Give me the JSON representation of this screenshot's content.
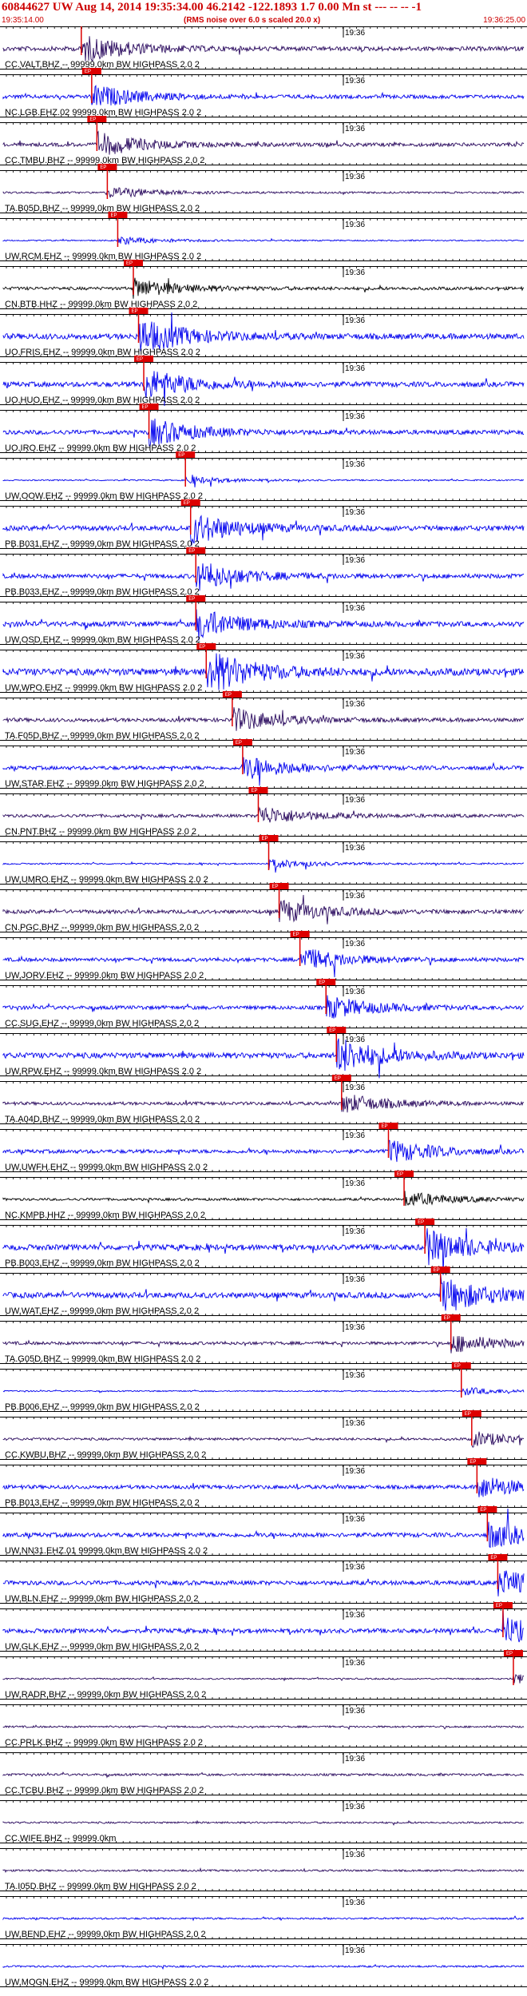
{
  "header": {
    "title": "60844627 UW Aug 14, 2014 19:35:34.00   46.2142 -122.1893  1.7 0.00 Mn st --- -- --  -1",
    "start_time": "19:35:14.00",
    "noise_note": "(RMS noise over 6.0 s scaled 20.0 x)",
    "end_time": "19:36:25.00"
  },
  "minute_marker": "19:36",
  "pick_label": "EP",
  "colors": {
    "header_text": "#cc0000",
    "pick": "#dd0000",
    "trace_dark": "#2a0a5e",
    "trace_blue": "#0000ee",
    "trace_black": "#000000",
    "grid": "#000000"
  },
  "stations": [
    {
      "label": "CC.VALT.BHZ -- 99999.0km BW  HIGHPASS  2.0  2",
      "color": "dark",
      "amp": 0.35,
      "pick": 0.15
    },
    {
      "label": "NC.LGB.EHZ.02 99999.0km BW  HIGHPASS  2.0  2",
      "color": "blue",
      "amp": 0.3,
      "pick": 0.17
    },
    {
      "label": "CC.TMBU.BHZ -- 99999.0km BW  HIGHPASS  2.0  2",
      "color": "dark",
      "amp": 0.3,
      "pick": 0.18
    },
    {
      "label": "TA.B05D.BHZ -- 99999.0km BW  HIGHPASS  2.0  2",
      "color": "dark",
      "amp": 0.15,
      "pick": 0.2
    },
    {
      "label": "UW.RCM.EHZ -- 99999.0km BW  HIGHPASS  2.0  2",
      "color": "blue",
      "amp": 0.1,
      "pick": 0.22
    },
    {
      "label": "CN.BTB.HHZ -- 99999.0km BW  HIGHPASS  2.0  2",
      "color": "black",
      "amp": 0.25,
      "pick": 0.25
    },
    {
      "label": "UO.FRIS.EHZ -- 99999.0km BW  HIGHPASS  2.0  2",
      "color": "blue",
      "amp": 0.45,
      "pick": 0.26
    },
    {
      "label": "UO.HUO.EHZ -- 99999.0km BW  HIGHPASS  2.0  2",
      "color": "blue",
      "amp": 0.4,
      "pick": 0.27
    },
    {
      "label": "UO.IRO.EHZ -- 99999.0km BW  HIGHPASS  2.0  2",
      "color": "blue",
      "amp": 0.35,
      "pick": 0.28
    },
    {
      "label": "UW.OOW.EHZ -- 99999.0km BW  HIGHPASS  2.0  2",
      "color": "blue",
      "amp": 0.1,
      "pick": 0.35
    },
    {
      "label": "PB.B031.EHZ -- 99999.0km BW  HIGHPASS  2.0  2",
      "color": "blue",
      "amp": 0.4,
      "pick": 0.36
    },
    {
      "label": "PB.B033.EHZ -- 99999.0km BW  HIGHPASS  2.0  2",
      "color": "blue",
      "amp": 0.35,
      "pick": 0.37
    },
    {
      "label": "UW.OSD.EHZ -- 99999.0km BW  HIGHPASS  2.0  2",
      "color": "blue",
      "amp": 0.4,
      "pick": 0.37
    },
    {
      "label": "UW.WPO.EHZ -- 99999.0km BW  HIGHPASS  2.0  2",
      "color": "blue",
      "amp": 0.55,
      "pick": 0.39
    },
    {
      "label": "TA.F05D.BHZ -- 99999.0km BW  HIGHPASS  2.0  2",
      "color": "dark",
      "amp": 0.3,
      "pick": 0.44
    },
    {
      "label": "UW.STAR.EHZ -- 99999.0km BW  HIGHPASS  2.0  2",
      "color": "blue",
      "amp": 0.3,
      "pick": 0.46
    },
    {
      "label": "CN.PNT.BHZ -- 99999.0km BW  HIGHPASS  2.0  2",
      "color": "dark",
      "amp": 0.25,
      "pick": 0.49
    },
    {
      "label": "UW.UMRO.EHZ -- 99999.0km BW  HIGHPASS  2.0  2",
      "color": "blue",
      "amp": 0.12,
      "pick": 0.51
    },
    {
      "label": "CN.PGC.BHZ -- 99999.0km BW  HIGHPASS  2.0  2",
      "color": "dark",
      "amp": 0.3,
      "pick": 0.53
    },
    {
      "label": "UW.JORV.EHZ -- 99999.0km BW  HIGHPASS  2.0  2",
      "color": "blue",
      "amp": 0.3,
      "pick": 0.57
    },
    {
      "label": "CC.SUG.EHZ -- 99999.0km BW  HIGHPASS  2.0  2",
      "color": "blue",
      "amp": 0.3,
      "pick": 0.62
    },
    {
      "label": "UW.RPW.EHZ -- 99999.0km BW  HIGHPASS  2.0  2",
      "color": "blue",
      "amp": 0.45,
      "pick": 0.64
    },
    {
      "label": "TA.A04D.BHZ -- 99999.0km BW  HIGHPASS  2.0  2",
      "color": "dark",
      "amp": 0.25,
      "pick": 0.65
    },
    {
      "label": "UW.UWFH.EHZ -- 99999.0km BW  HIGHPASS  2.0  2",
      "color": "blue",
      "amp": 0.3,
      "pick": 0.74
    },
    {
      "label": "NC.KMPB.HHZ -- 99999.0km BW  HIGHPASS  2.0  2",
      "color": "black",
      "amp": 0.2,
      "pick": 0.77
    },
    {
      "label": "PB.B003.EHZ -- 99999.0km BW  HIGHPASS  2.0  2",
      "color": "blue",
      "amp": 0.45,
      "pick": 0.81
    },
    {
      "label": "UW.WAT.EHZ -- 99999.0km BW  HIGHPASS  2.0  2",
      "color": "blue",
      "amp": 0.45,
      "pick": 0.84
    },
    {
      "label": "TA.G05D.BHZ -- 99999.0km BW  HIGHPASS  2.0  2",
      "color": "dark",
      "amp": 0.25,
      "pick": 0.86
    },
    {
      "label": "PB.B006.EHZ -- 99999.0km BW  HIGHPASS  2.0  2",
      "color": "blue",
      "amp": 0.1,
      "pick": 0.88
    },
    {
      "label": "CC.KWBU.BHZ -- 99999.0km BW  HIGHPASS  2.0  2",
      "color": "dark",
      "amp": 0.2,
      "pick": 0.9
    },
    {
      "label": "PB.B013.EHZ -- 99999.0km BW  HIGHPASS  2.0  2",
      "color": "blue",
      "amp": 0.3,
      "pick": 0.91
    },
    {
      "label": "UW.NN31.EHZ.01 99999.0km BW  HIGHPASS  2.0  2",
      "color": "blue",
      "amp": 0.35,
      "pick": 0.93
    },
    {
      "label": "UW.BLN.EHZ -- 99999.0km BW  HIGHPASS  2.0  2",
      "color": "blue",
      "amp": 0.35,
      "pick": 0.95
    },
    {
      "label": "UW.GLK.EHZ -- 99999.0km BW  HIGHPASS  2.0  2",
      "color": "blue",
      "amp": 0.35,
      "pick": 0.96
    },
    {
      "label": "UW.RADR.BHZ -- 99999.0km BW  HIGHPASS  2.0  2",
      "color": "dark",
      "amp": 0.12,
      "pick": 0.98
    },
    {
      "label": "CC.PRLK.BHZ -- 99999.0km BW  HIGHPASS  2.0  2",
      "color": "dark",
      "amp": 0.15,
      "pick": null
    },
    {
      "label": "CC.TCBU.BHZ -- 99999.0km BW  HIGHPASS  2.0  2",
      "color": "dark",
      "amp": 0.18,
      "pick": null
    },
    {
      "label": "CC.WIFE.BHZ -- 99999.0km",
      "color": "dark",
      "amp": 0.15,
      "pick": null
    },
    {
      "label": "TA.I05D.BHZ -- 99999.0km BW  HIGHPASS  2.0  2",
      "color": "dark",
      "amp": 0.15,
      "pick": null
    },
    {
      "label": "UW.BEND.EHZ -- 99999.0km BW  HIGHPASS  2.0  2",
      "color": "blue",
      "amp": 0.15,
      "pick": null
    },
    {
      "label": "UW.MOGN.EHZ -- 99999.0km BW  HIGHPASS  2.0  2",
      "color": "blue",
      "amp": 0.15,
      "pick": null
    }
  ]
}
